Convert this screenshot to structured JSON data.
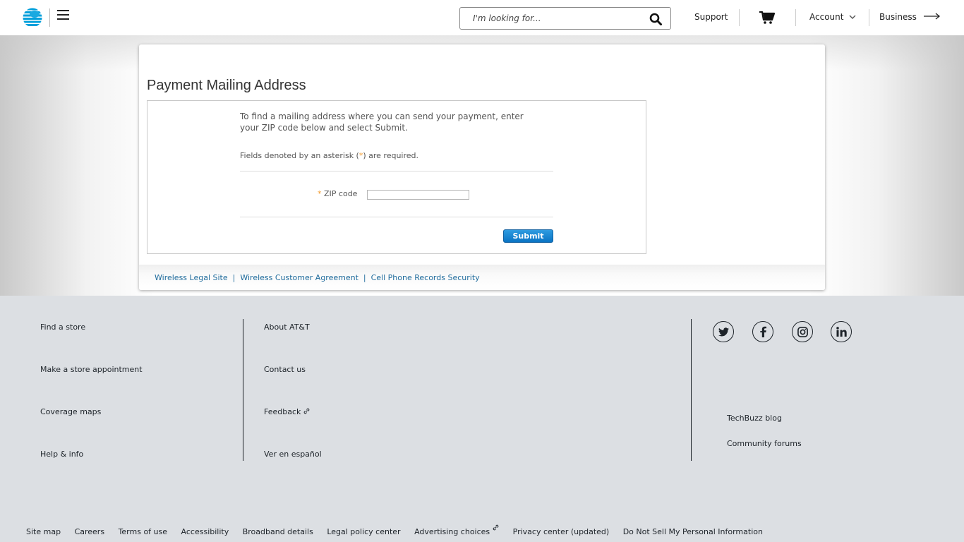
{
  "header": {
    "logo": "att-globe-logo",
    "search_placeholder": "I'm looking for...",
    "support_label": "Support",
    "account_label": "Account",
    "business_label": "Business"
  },
  "main": {
    "title": "Payment Mailing Address",
    "intro": "To find a mailing address where you can send your payment, enter your ZIP code below and select Submit.",
    "required_note_prefix": "Fields denoted by an asterisk (",
    "required_note_star": "*",
    "required_note_suffix": ") are required.",
    "zip_label": "ZIP code",
    "zip_value": "",
    "submit_label": "Submit",
    "legal_links": [
      "Wireless Legal Site",
      "Wireless Customer Agreement",
      "Cell Phone Records Security"
    ],
    "legal_sep": "|"
  },
  "footer": {
    "col1": [
      "Find a store",
      "Make a store appointment",
      "Coverage maps",
      "Help & info"
    ],
    "col2": [
      "About AT&T",
      "Contact us",
      "Feedback",
      "Ver en español"
    ],
    "social": [
      "twitter",
      "facebook",
      "instagram",
      "linkedin"
    ],
    "col3": [
      "TechBuzz blog",
      "Community forums"
    ],
    "bottom": [
      "Site map",
      "Careers",
      "Terms of use",
      "Accessibility",
      "Broadband details",
      "Legal policy center",
      "Advertising choices",
      "Privacy center (updated)",
      "Do Not Sell My Personal Information"
    ]
  },
  "colors": {
    "brand_blue": "#009fdb",
    "link_blue": "#1f6b9c",
    "required_orange": "#f29b2e",
    "button_blue": "#0a74c4"
  }
}
